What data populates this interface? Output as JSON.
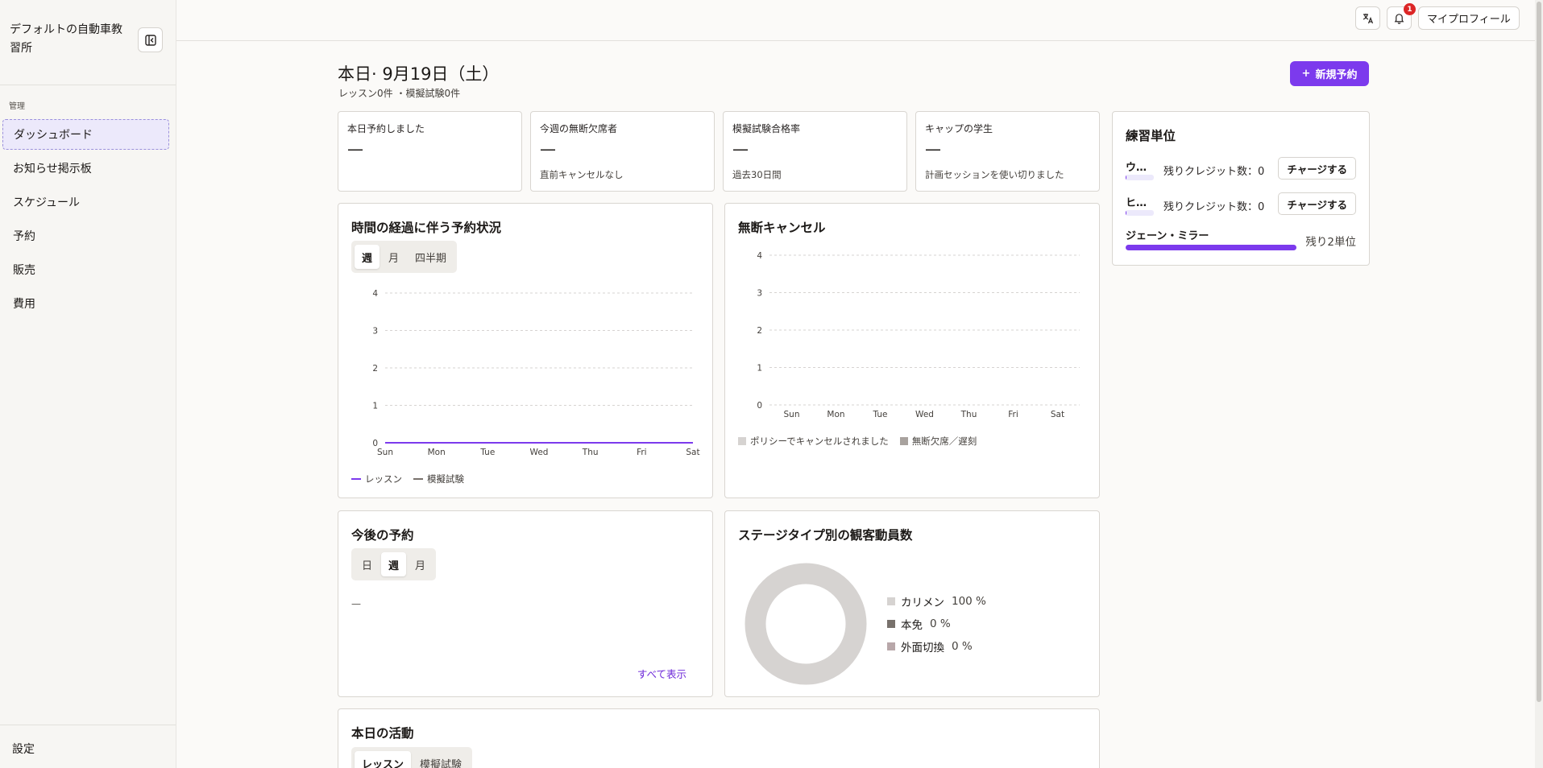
{
  "sidebar": {
    "brand": "デフォルトの自動車教習所",
    "section_label": "管理",
    "items": [
      {
        "label": "ダッシュボード",
        "active": true
      },
      {
        "label": "お知らせ掲示板"
      },
      {
        "label": "スケジュール"
      },
      {
        "label": "予約"
      },
      {
        "label": "販売"
      },
      {
        "label": "費用"
      }
    ],
    "settings_label": "設定"
  },
  "topbar": {
    "notification_count": "1",
    "profile_label": "マイプロフィール"
  },
  "header": {
    "title": "本日· 9月19日（土）",
    "subtitle": "レッスン0件 ・模擬試験0件",
    "new_booking_label": "新規予約"
  },
  "stats": [
    {
      "label": "本日予約しました",
      "value": "—",
      "sub": ""
    },
    {
      "label": "今週の無断欠席者",
      "value": "—",
      "sub": "直前キャンセルなし"
    },
    {
      "label": "模擬試験合格率",
      "value": "—",
      "sub": "過去30日間"
    },
    {
      "label": "キャップの学生",
      "value": "—",
      "sub": "計画セッションを使い切りました"
    }
  ],
  "bookings_chart": {
    "title": "時間の経過に伴う予約状況",
    "tabs": [
      "週",
      "月",
      "四半期"
    ],
    "active_tab": 0
  },
  "noshow_chart": {
    "title": "無断キャンセル"
  },
  "upcoming": {
    "title": "今後の予約",
    "tabs": [
      "日",
      "週",
      "月"
    ],
    "active_tab": 1,
    "empty": "—",
    "view_all": "すべて表示"
  },
  "stage_chart": {
    "title": "ステージタイプ別の観客動員数"
  },
  "activity": {
    "title": "本日の活動",
    "tabs": [
      "レッスン",
      "模擬試験"
    ],
    "active_tab": 0
  },
  "practice_units": {
    "title": "練習単位",
    "rows": [
      {
        "name": "ウ…",
        "credit": "残りクレジット数：0",
        "button": "チャージする",
        "progress": 0.04
      },
      {
        "name": "ヒ…",
        "credit": "残りクレジット数：0",
        "button": "チャージする",
        "progress": 0.04
      }
    ],
    "highlight": {
      "name": "ジェーン・ミラー",
      "remaining": "残り2単位",
      "progress": 1.0
    }
  },
  "colors": {
    "accent": "#7c3aed",
    "lesson": "#7c3aed",
    "mock_exam": "#78716c",
    "policy_cancel": "#d6d3d1",
    "noshow_late": "#a8a29e",
    "carmen": "#d6d3d1",
    "honmen": "#78716c",
    "gaimen": "#b8a7a9"
  },
  "chart_data": [
    {
      "type": "line",
      "categories": [
        "Sun",
        "Mon",
        "Tue",
        "Wed",
        "Thu",
        "Fri",
        "Sat"
      ],
      "yticks": [
        "0",
        "1",
        "2",
        "3",
        "4"
      ],
      "ylim": [
        0,
        4
      ],
      "grid": true,
      "legend_position": "bottom-left",
      "series": [
        {
          "name": "レッスン",
          "values": [
            0,
            0,
            0,
            0,
            0,
            0,
            0
          ]
        },
        {
          "name": "模擬試験",
          "values": [
            0,
            0,
            0,
            0,
            0,
            0,
            0
          ]
        }
      ]
    },
    {
      "type": "bar",
      "categories": [
        "Sun",
        "Mon",
        "Tue",
        "Wed",
        "Thu",
        "Fri",
        "Sat"
      ],
      "yticks": [
        "0",
        "1",
        "2",
        "3",
        "4"
      ],
      "ylim": [
        0,
        4
      ],
      "grid": true,
      "legend_position": "bottom-left",
      "series": [
        {
          "name": "ポリシーでキャンセルされました",
          "values": [
            0,
            0,
            0,
            0,
            0,
            0,
            0
          ]
        },
        {
          "name": "無断欠席／遅刻",
          "values": [
            0,
            0,
            0,
            0,
            0,
            0,
            0
          ]
        }
      ]
    },
    {
      "type": "pie",
      "slices": [
        {
          "label": "カリメン",
          "value": 100,
          "display": "100 %"
        },
        {
          "label": "本免",
          "value": 0,
          "display": "0 %"
        },
        {
          "label": "外面切換",
          "value": 0,
          "display": "0 %"
        }
      ]
    }
  ]
}
